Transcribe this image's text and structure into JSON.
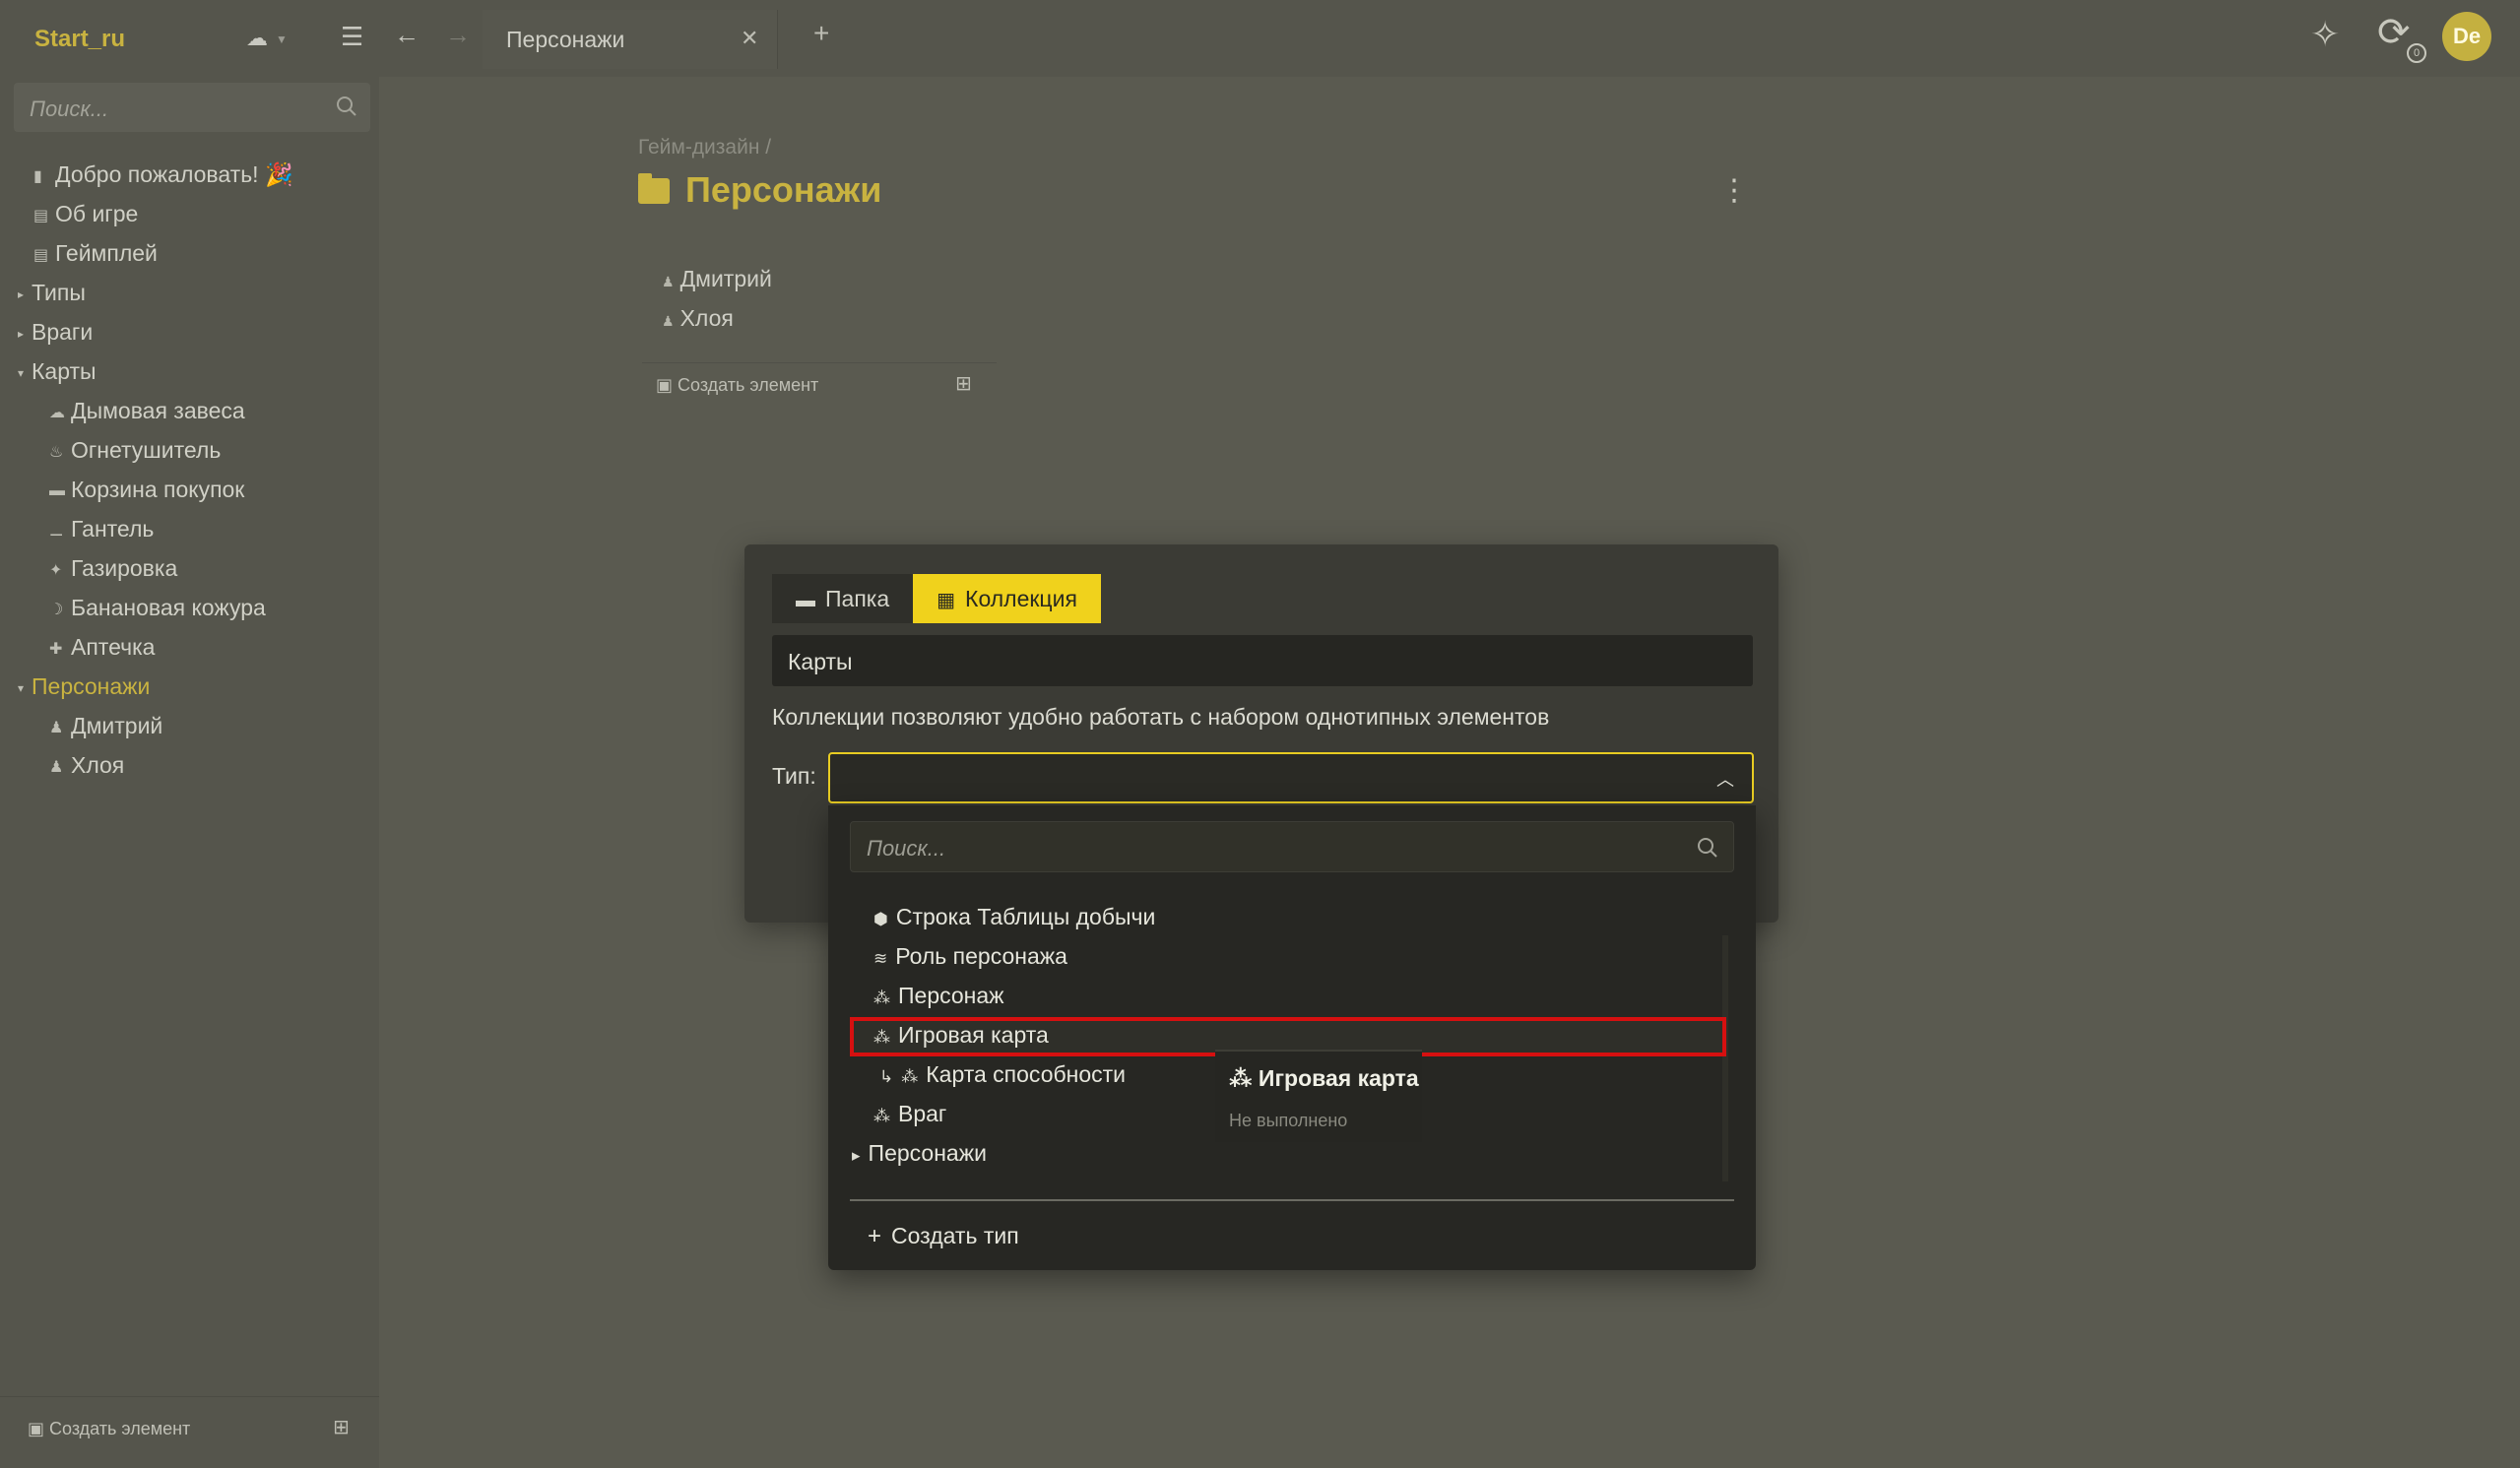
{
  "app": {
    "workspace": "Start_ru",
    "tab_title": "Персонажи",
    "tab_close": "✕",
    "tab_add": "+",
    "avatar": "De",
    "sync_badge": "0"
  },
  "sidebar": {
    "search_placeholder": "Поиск...",
    "items": [
      {
        "label": "Добро пожаловать! 🎉",
        "icon": "doc-icon",
        "glyph": "▮"
      },
      {
        "label": "Об игре",
        "icon": "board-icon",
        "glyph": "▤"
      },
      {
        "label": "Геймплей",
        "icon": "board-icon",
        "glyph": "▤"
      },
      {
        "label": "Типы",
        "icon": "caret-right-icon",
        "glyph": "▸"
      },
      {
        "label": "Враги",
        "icon": "caret-right-icon",
        "glyph": "▸"
      },
      {
        "label": "Карты",
        "icon": "caret-down-icon",
        "glyph": "▾"
      },
      {
        "label": "Дымовая завеса",
        "icon": "item-icon",
        "glyph": "☁"
      },
      {
        "label": "Огнетушитель",
        "icon": "item-icon",
        "glyph": "♨"
      },
      {
        "label": "Корзина покупок",
        "icon": "item-icon",
        "glyph": "▬"
      },
      {
        "label": "Гантель",
        "icon": "item-icon",
        "glyph": "⚊"
      },
      {
        "label": "Газировка",
        "icon": "item-icon",
        "glyph": "✦"
      },
      {
        "label": "Банановая кожура",
        "icon": "item-icon",
        "glyph": "☽"
      },
      {
        "label": "Аптечка",
        "icon": "item-icon",
        "glyph": "✚"
      },
      {
        "label": "Персонажи",
        "icon": "caret-down-icon",
        "glyph": "▾"
      },
      {
        "label": "Дмитрий",
        "icon": "person-icon",
        "glyph": "♟"
      },
      {
        "label": "Хлоя",
        "icon": "person-icon",
        "glyph": "♟"
      }
    ],
    "create_label": "Создать элемент"
  },
  "page": {
    "breadcrumb": "Гейм-дизайн /",
    "title": "Персонажи",
    "children": [
      "Дмитрий",
      "Хлоя"
    ],
    "create_label": "Создать элемент"
  },
  "modal": {
    "tab_folder": "Папка",
    "tab_collection": "Коллекция",
    "name_value": "Карты",
    "description": "Коллекции позволяют удобно работать с набором однотипных элементов",
    "type_label": "Тип:",
    "type_value": ""
  },
  "dropdown": {
    "search_placeholder": "Поиск...",
    "options": [
      {
        "label": "Строка Таблицы добычи",
        "glyph": "⬢"
      },
      {
        "label": "Роль персонажа",
        "glyph": "≋"
      },
      {
        "label": "Персонаж",
        "glyph": "⁂"
      },
      {
        "label": "Игровая карта",
        "glyph": "⁂"
      },
      {
        "label": "Карта способности",
        "glyph": "⁂",
        "prefix": "↳"
      },
      {
        "label": "Враг",
        "glyph": "⁂"
      },
      {
        "label": "Персонажи",
        "glyph": "▸"
      }
    ],
    "highlighted": "Игровая карта",
    "tooltip_title": "Игровая карта",
    "tooltip_sub": "Не выполнено",
    "create_type": "Создать тип"
  }
}
